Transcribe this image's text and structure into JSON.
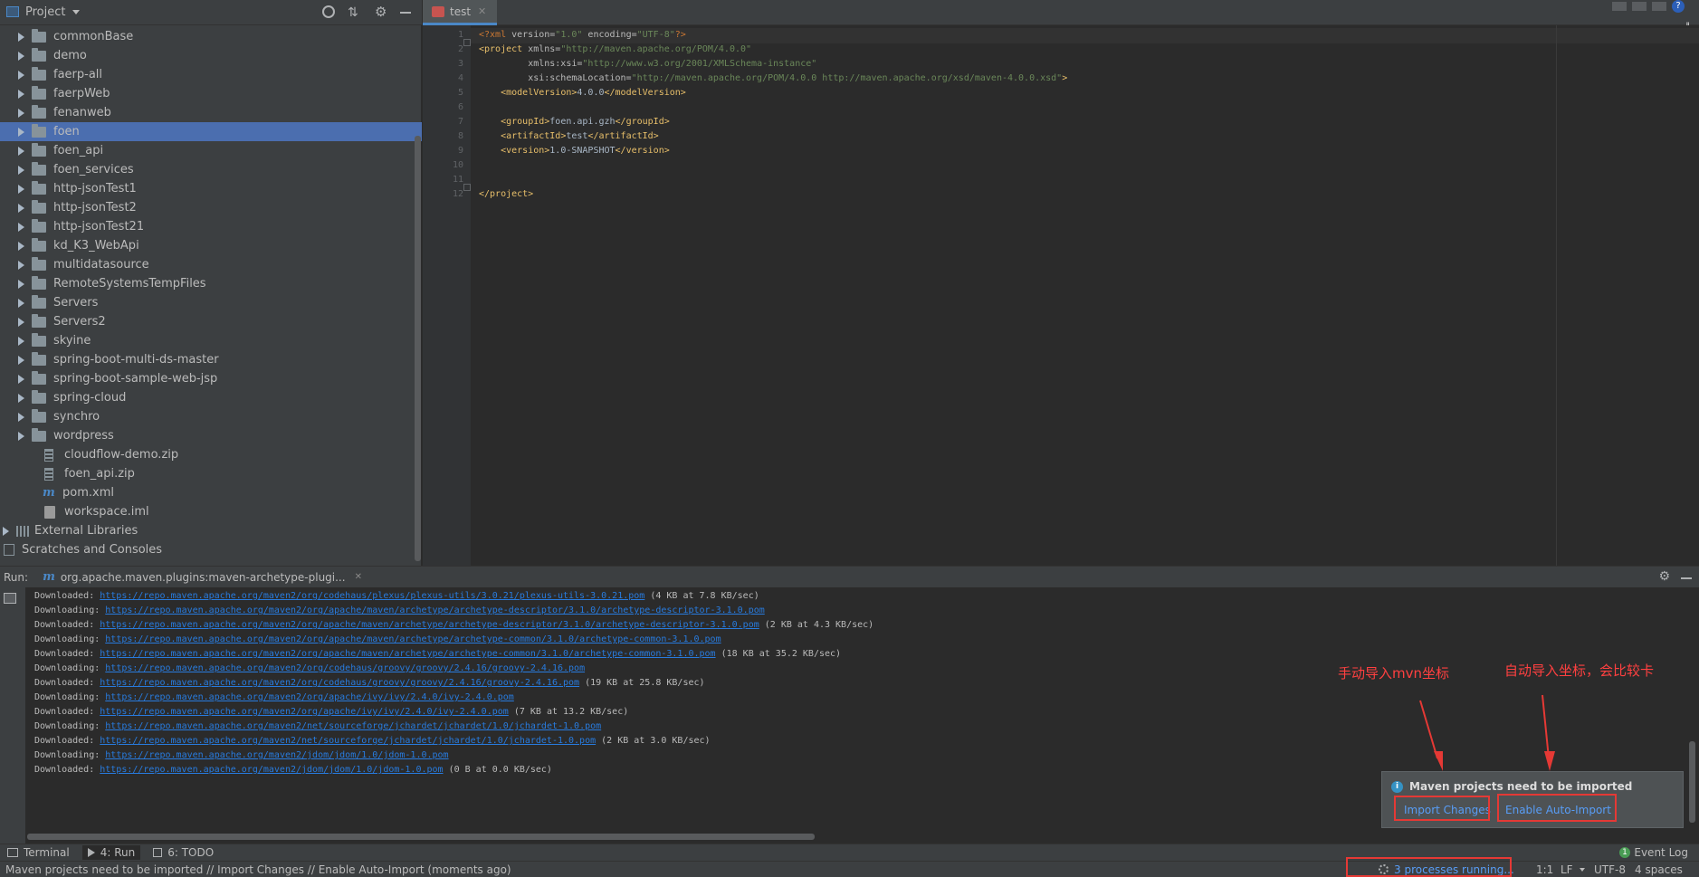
{
  "project_panel": {
    "title": "Project",
    "items": [
      {
        "label": "commonBase",
        "type": "folder"
      },
      {
        "label": "demo",
        "type": "folder"
      },
      {
        "label": "faerp-all",
        "type": "folder"
      },
      {
        "label": "faerpWeb",
        "type": "folder"
      },
      {
        "label": "fenanweb",
        "type": "folder"
      },
      {
        "label": "foen",
        "type": "folder",
        "selected": true
      },
      {
        "label": "foen_api",
        "type": "folder"
      },
      {
        "label": "foen_services",
        "type": "folder"
      },
      {
        "label": "http-jsonTest1",
        "type": "folder"
      },
      {
        "label": "http-jsonTest2",
        "type": "folder"
      },
      {
        "label": "http-jsonTest21",
        "type": "folder"
      },
      {
        "label": "kd_K3_WebApi",
        "type": "folder"
      },
      {
        "label": "multidatasource",
        "type": "folder"
      },
      {
        "label": "RemoteSystemsTempFiles",
        "type": "folder"
      },
      {
        "label": "Servers",
        "type": "folder"
      },
      {
        "label": "Servers2",
        "type": "folder"
      },
      {
        "label": "skyine",
        "type": "folder"
      },
      {
        "label": "spring-boot-multi-ds-master",
        "type": "folder"
      },
      {
        "label": "spring-boot-sample-web-jsp",
        "type": "folder"
      },
      {
        "label": "spring-cloud",
        "type": "folder"
      },
      {
        "label": "synchro",
        "type": "folder"
      },
      {
        "label": "wordpress",
        "type": "folder"
      },
      {
        "label": "cloudflow-demo.zip",
        "type": "zip"
      },
      {
        "label": "foen_api.zip",
        "type": "zip"
      },
      {
        "label": "pom.xml",
        "type": "maven"
      },
      {
        "label": "workspace.iml",
        "type": "iml"
      }
    ],
    "external_libraries": "External Libraries",
    "scratches": "Scratches and Consoles"
  },
  "editor": {
    "tab_label": "test",
    "line_numbers": [
      "1",
      "2",
      "3",
      "4",
      "5",
      "6",
      "7",
      "8",
      "9",
      "10",
      "11",
      "12"
    ]
  },
  "run_panel": {
    "label": "Run:",
    "tab_label": "org.apache.maven.plugins:maven-archetype-plugi...",
    "log": [
      {
        "prefix": "Downloaded: ",
        "url": "https://repo.maven.apache.org/maven2/org/codehaus/plexus/plexus-utils/3.0.21/plexus-utils-3.0.21.pom",
        "suffix": " (4 KB at 7.8 KB/sec)"
      },
      {
        "prefix": "Downloading: ",
        "url": "https://repo.maven.apache.org/maven2/org/apache/maven/archetype/archetype-descriptor/3.1.0/archetype-descriptor-3.1.0.pom",
        "suffix": ""
      },
      {
        "prefix": "Downloaded: ",
        "url": "https://repo.maven.apache.org/maven2/org/apache/maven/archetype/archetype-descriptor/3.1.0/archetype-descriptor-3.1.0.pom",
        "suffix": " (2 KB at 4.3 KB/sec)"
      },
      {
        "prefix": "Downloading: ",
        "url": "https://repo.maven.apache.org/maven2/org/apache/maven/archetype/archetype-common/3.1.0/archetype-common-3.1.0.pom",
        "suffix": ""
      },
      {
        "prefix": "Downloaded: ",
        "url": "https://repo.maven.apache.org/maven2/org/apache/maven/archetype/archetype-common/3.1.0/archetype-common-3.1.0.pom",
        "suffix": " (18 KB at 35.2 KB/sec)"
      },
      {
        "prefix": "Downloading: ",
        "url": "https://repo.maven.apache.org/maven2/org/codehaus/groovy/groovy/2.4.16/groovy-2.4.16.pom",
        "suffix": ""
      },
      {
        "prefix": "Downloaded: ",
        "url": "https://repo.maven.apache.org/maven2/org/codehaus/groovy/groovy/2.4.16/groovy-2.4.16.pom",
        "suffix": " (19 KB at 25.8 KB/sec)"
      },
      {
        "prefix": "Downloading: ",
        "url": "https://repo.maven.apache.org/maven2/org/apache/ivy/ivy/2.4.0/ivy-2.4.0.pom",
        "suffix": ""
      },
      {
        "prefix": "Downloaded: ",
        "url": "https://repo.maven.apache.org/maven2/org/apache/ivy/ivy/2.4.0/ivy-2.4.0.pom",
        "suffix": " (7 KB at 13.2 KB/sec)"
      },
      {
        "prefix": "Downloading: ",
        "url": "https://repo.maven.apache.org/maven2/net/sourceforge/jchardet/jchardet/1.0/jchardet-1.0.pom",
        "suffix": ""
      },
      {
        "prefix": "Downloaded: ",
        "url": "https://repo.maven.apache.org/maven2/net/sourceforge/jchardet/jchardet/1.0/jchardet-1.0.pom",
        "suffix": " (2 KB at 3.0 KB/sec)"
      },
      {
        "prefix": "Downloading: ",
        "url": "https://repo.maven.apache.org/maven2/jdom/jdom/1.0/jdom-1.0.pom",
        "suffix": ""
      },
      {
        "prefix": "Downloaded: ",
        "url": "https://repo.maven.apache.org/maven2/jdom/jdom/1.0/jdom-1.0.pom",
        "suffix": " (0 B at 0.0 KB/sec)"
      }
    ]
  },
  "notification": {
    "title": "Maven projects need to be imported",
    "import_changes": "Import Changes",
    "enable_auto_import": "Enable Auto-Import"
  },
  "annotations": {
    "manual": "手动导入mvn坐标",
    "auto": "自动导入坐标，会比较卡",
    "color": "#ff4040"
  },
  "tool_windows": {
    "terminal": "Terminal",
    "run": "4: Run",
    "todo": "6: TODO",
    "event_log": "Event Log"
  },
  "status_bar": {
    "message": "Maven projects need to be imported // Import Changes // Enable Auto-Import (moments ago)",
    "processes": "3 processes running...",
    "position": "1:1",
    "line_sep": "LF",
    "encoding": "UTF-8",
    "indent": "4 spaces"
  },
  "colors": {
    "selection": "#4b6eaf",
    "link": "#287bde",
    "highlight_box": "#e53935"
  }
}
